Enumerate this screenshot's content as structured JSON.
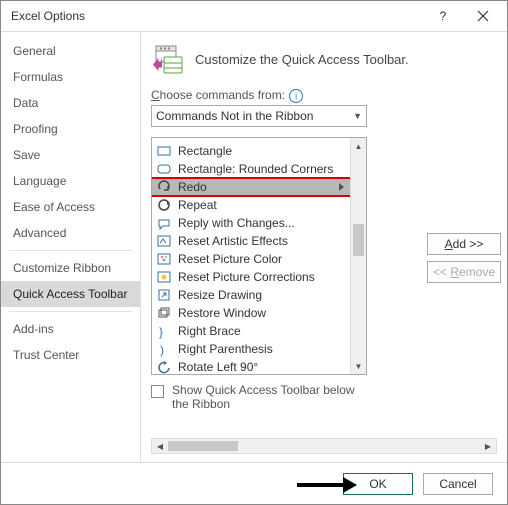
{
  "titlebar": {
    "title": "Excel Options"
  },
  "sidebar": {
    "items": [
      "General",
      "Formulas",
      "Data",
      "Proofing",
      "Save",
      "Language",
      "Ease of Access",
      "Advanced"
    ],
    "items2": [
      "Customize Ribbon",
      "Quick Access Toolbar"
    ],
    "items3": [
      "Add-ins",
      "Trust Center"
    ],
    "selected": "Quick Access Toolbar"
  },
  "main": {
    "header": "Customize the Quick Access Toolbar.",
    "choose_prefix": "C",
    "choose_rest": "hoose commands from:",
    "dropdown_value": "Commands Not in the Ribbon",
    "commands_partial_top": "",
    "commands": [
      "Rectangle",
      "Rectangle: Rounded Corners",
      "Redo",
      "Repeat",
      "Reply with Changes...",
      "Reset Artistic Effects",
      "Reset Picture Color",
      "Reset Picture Corrections",
      "Resize Drawing",
      "Restore Window",
      "Right Brace",
      "Right Parenthesis",
      "Rotate Left 90°"
    ],
    "selected_command_index": 2,
    "checkbox_prefix": "S",
    "checkbox_rest": "how Quick Access Toolbar below the Ribbon"
  },
  "buttons": {
    "add_u": "A",
    "add_rest": "dd >>",
    "remove_prefix": "<< ",
    "remove_u": "R",
    "remove_rest": "emove",
    "ok": "OK",
    "cancel": "Cancel"
  }
}
